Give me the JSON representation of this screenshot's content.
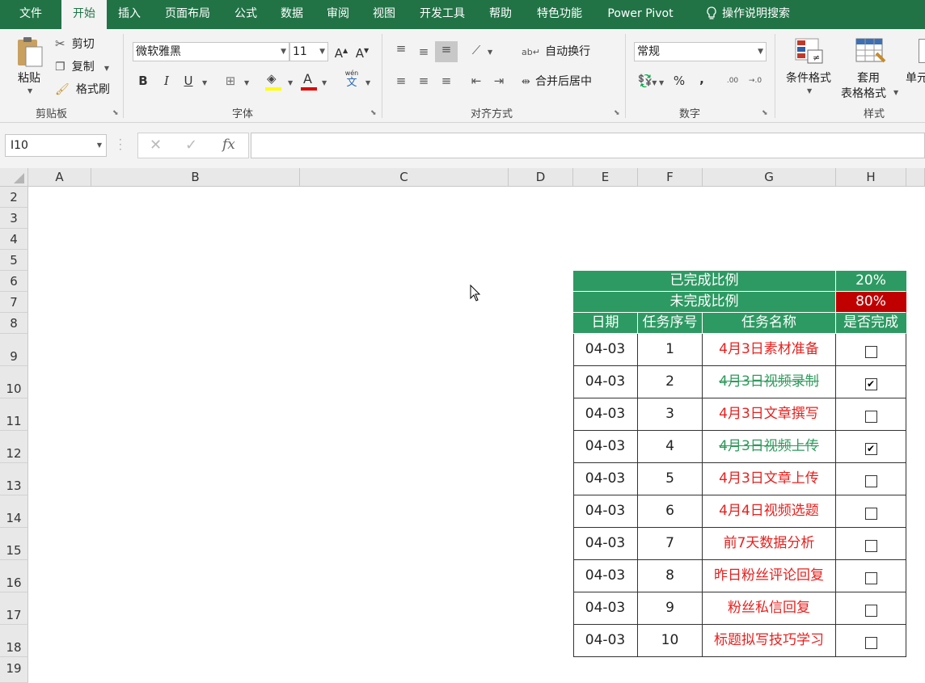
{
  "menu": {
    "items": [
      "文件",
      "开始",
      "插入",
      "页面布局",
      "公式",
      "数据",
      "审阅",
      "视图",
      "开发工具",
      "帮助",
      "特色功能",
      "Power Pivot"
    ],
    "active": "开始",
    "search_label": "操作说明搜索"
  },
  "ribbon": {
    "clipboard": {
      "paste": "粘贴",
      "cut": "剪切",
      "copy": "复制",
      "format_painter": "格式刷",
      "label": "剪贴板"
    },
    "font": {
      "name": "微软雅黑",
      "size": "11",
      "bold": "B",
      "italic": "I",
      "underline": "U",
      "label": "字体",
      "phonetic": "wén"
    },
    "alignment": {
      "wrap": "自动换行",
      "merge": "合并后居中",
      "label": "对齐方式"
    },
    "number": {
      "format": "常规",
      "percent": "%",
      "comma": ",",
      "inc_dec": ".00",
      "label": "数字"
    },
    "styles": {
      "conditional": "条件格式",
      "table_line1": "套用",
      "table_line2": "表格格式",
      "cell_styles": "单元",
      "label": "样式"
    }
  },
  "formula_bar": {
    "name_box": "I10",
    "fx": "fx",
    "formula": ""
  },
  "colors": {
    "green": "#217346",
    "header_green": "#2e9a63",
    "red": "#e8201e",
    "done_green": "#2f9a5c",
    "pct_red": "#c00000"
  },
  "sheet": {
    "columns": [
      "A",
      "B",
      "C",
      "D",
      "E",
      "F",
      "G",
      "H"
    ],
    "rows": [
      "2",
      "3",
      "4",
      "5",
      "6",
      "7",
      "8",
      "9",
      "10",
      "11",
      "12",
      "13",
      "14",
      "15",
      "16",
      "17",
      "18",
      "19"
    ],
    "completed_label": "已完成比例",
    "completed_value": "20%",
    "uncompleted_label": "未完成比例",
    "uncompleted_value": "80%",
    "headers": [
      "日期",
      "任务序号",
      "任务名称",
      "是否完成"
    ],
    "tasks": [
      {
        "date": "04-03",
        "no": "1",
        "name": "4月3日素材准备",
        "done": false
      },
      {
        "date": "04-03",
        "no": "2",
        "name": "4月3日视频录制",
        "done": true
      },
      {
        "date": "04-03",
        "no": "3",
        "name": "4月3日文章撰写",
        "done": false
      },
      {
        "date": "04-03",
        "no": "4",
        "name": "4月3日视频上传",
        "done": true
      },
      {
        "date": "04-03",
        "no": "5",
        "name": "4月3日文章上传",
        "done": false
      },
      {
        "date": "04-03",
        "no": "6",
        "name": "4月4日视频选题",
        "done": false
      },
      {
        "date": "04-03",
        "no": "7",
        "name": "前7天数据分析",
        "done": false
      },
      {
        "date": "04-03",
        "no": "8",
        "name": "昨日粉丝评论回复",
        "done": false
      },
      {
        "date": "04-03",
        "no": "9",
        "name": "粉丝私信回复",
        "done": false
      },
      {
        "date": "04-03",
        "no": "10",
        "name": "标题拟写技巧学习",
        "done": false
      }
    ]
  }
}
